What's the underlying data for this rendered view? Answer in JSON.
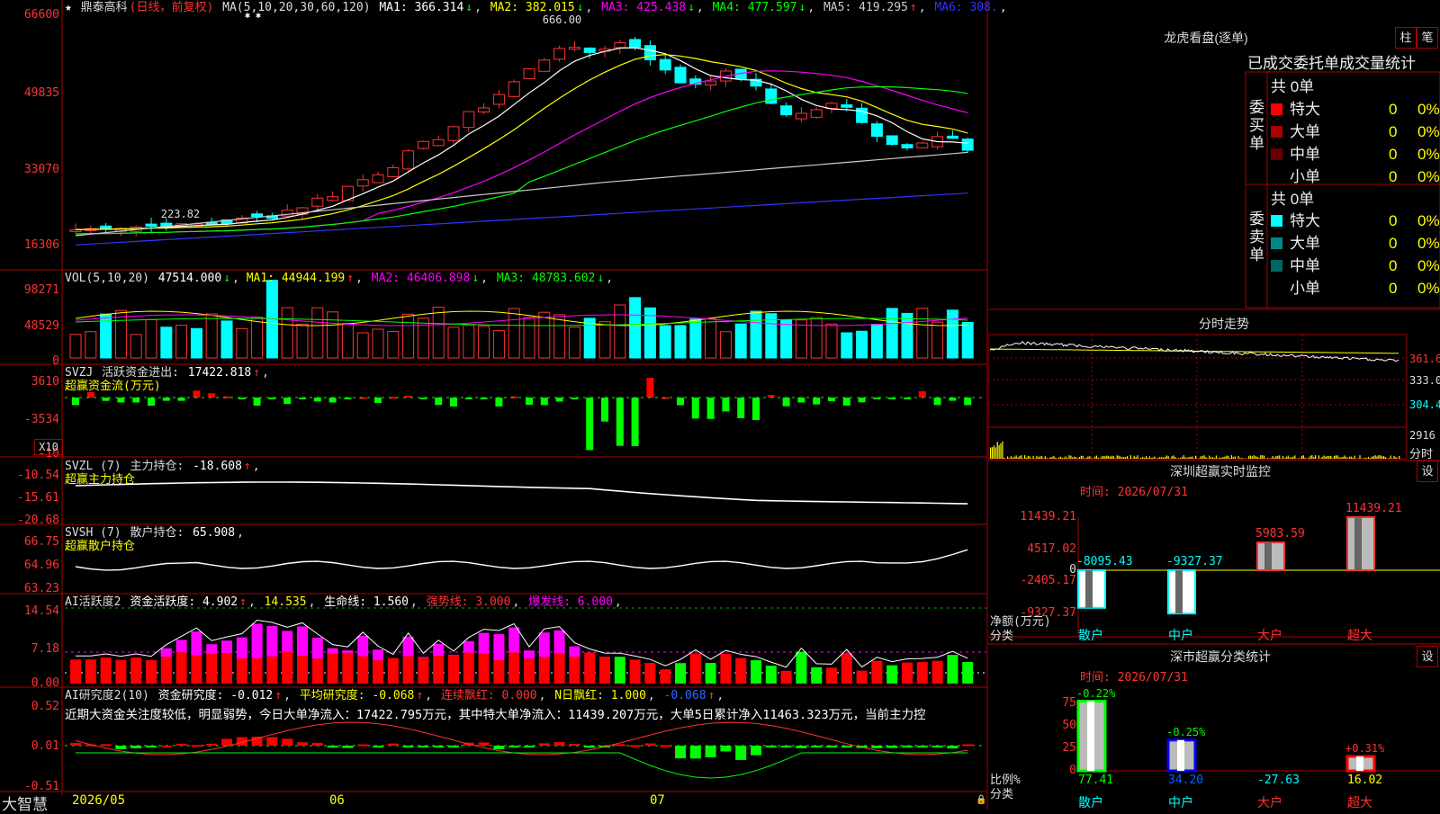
{
  "stock": {
    "name": "鼎泰高科",
    "period": "(日线，前复权)",
    "logo": "大智慧"
  },
  "panel_price": {
    "ma_prefix": "MA(5,10,20,30,60,120)",
    "ma": [
      {
        "label": "MA1:",
        "value": "366.314",
        "arrow": "↓",
        "color": "#ffffff"
      },
      {
        "label": "MA2:",
        "value": "382.015",
        "arrow": "↓",
        "color": "#ffff00"
      },
      {
        "label": "MA3:",
        "value": "425.438",
        "arrow": "↓",
        "color": "#ff00ff"
      },
      {
        "label": "MA4:",
        "value": "477.597",
        "arrow": "↓",
        "color": "#00ff00"
      },
      {
        "label": "MA5:",
        "value": "419.295",
        "arrow": "↑",
        "color": "#cccccc"
      },
      {
        "label": "MA6:",
        "value": "308.",
        "arrow": "",
        "color": "#3333ff"
      }
    ],
    "y_ticks": [
      "66600",
      "49835",
      "33070",
      "16306"
    ],
    "high_label": "666.00",
    "low_label": "223.82"
  },
  "panel_vol": {
    "title": "VOL(5,10,20)",
    "value": "47514.000",
    "items": [
      {
        "label": "MA1:",
        "value": "44944.199",
        "arrow": "↑",
        "color": "#ffff00"
      },
      {
        "label": "MA2:",
        "value": "46406.898",
        "arrow": "↓",
        "color": "#ff00ff"
      },
      {
        "label": "MA3:",
        "value": "48783.602",
        "arrow": "↓",
        "color": "#00ff00"
      }
    ],
    "y_ticks": [
      "98271",
      "48529",
      "0"
    ]
  },
  "panel_svzj": {
    "title": "SVZJ",
    "label": "活跃资金进出:",
    "value": "17422.818",
    "arrow": "↑",
    "sub": "超赢资金流(万元)",
    "y_ticks": [
      "3610",
      "-3534",
      "-10"
    ],
    "x10": "X10"
  },
  "panel_svzl": {
    "title": "SVZL (7)",
    "label": "主力持仓:",
    "value": "-18.608",
    "arrow": "↑",
    "sub": "超赢主力持仓",
    "y_ticks": [
      "-10.54",
      "-15.61",
      "-20.68"
    ]
  },
  "panel_svsh": {
    "title": "SVSH (7)",
    "label": "散户持仓:",
    "value": "65.908",
    "sub": "超赢散户持仓",
    "y_ticks": [
      "66.75",
      "64.96",
      "63.23"
    ]
  },
  "panel_ai1": {
    "title": "AI活跃度2",
    "items": [
      {
        "label": "资金活跃度:",
        "value": "4.902",
        "arrow": "↑",
        "color": "#ffffff"
      },
      {
        "label": "",
        "value": "14.535",
        "arrow": "",
        "color": "#ffff00"
      },
      {
        "label": "生命线:",
        "value": "1.560",
        "arrow": "",
        "color": "#ffffff"
      },
      {
        "label": "强势线:",
        "value": "3.000",
        "arrow": "",
        "color": "#ff3333"
      },
      {
        "label": "爆发线:",
        "value": "6.000",
        "arrow": "",
        "color": "#ff00ff"
      }
    ],
    "y_ticks": [
      "14.54",
      "7.18",
      "0.00"
    ]
  },
  "panel_ai2": {
    "title": "AI研究度2(10)",
    "items": [
      {
        "label": "资金研究度:",
        "value": "-0.012",
        "arrow": "↑",
        "color": "#ffffff"
      },
      {
        "label": "平均研究度:",
        "value": "-0.068",
        "arrow": "↑",
        "color": "#ffff00"
      },
      {
        "label": "连续飘红:",
        "value": "0.000",
        "arrow": "",
        "color": "#ff3333"
      },
      {
        "label": "N日飘红:",
        "value": "1.000",
        "arrow": "",
        "color": "#ffff00"
      },
      {
        "label": "",
        "value": "-0.068",
        "arrow": "↑",
        "color": "#3366ff"
      }
    ],
    "note": "近期大资金关注度较低，明显弱势，今日大单净流入：17422.795万元，其中特大单净流入：11439.207万元，大单5日累计净入11463.323万元，当前主力控",
    "y_ticks": [
      "0.52",
      "0.01",
      "-0.51"
    ]
  },
  "x_axis": [
    "2026/05",
    "06",
    "07"
  ],
  "dragon": {
    "title": "龙虎看盘(逐单)",
    "btn1": "柱",
    "btn2": "笔",
    "header": "已成交委托单成交量统计",
    "buy_side": "委买单",
    "sell_side": "委卖单",
    "buy_total": "共 0单",
    "sell_total": "共 0单",
    "buy_rows": [
      {
        "name": "特大",
        "val": "0",
        "pct": "0%",
        "color": "#ff0000"
      },
      {
        "name": "大单",
        "val": "0",
        "pct": "0%",
        "color": "#aa0000"
      },
      {
        "name": "中单",
        "val": "0",
        "pct": "0%",
        "color": "#660000"
      },
      {
        "name": "小单",
        "val": "0",
        "pct": "0%",
        "color": "#000000"
      }
    ],
    "sell_rows": [
      {
        "name": "特大",
        "val": "0",
        "pct": "0%",
        "color": "#00ffff"
      },
      {
        "name": "大单",
        "val": "0",
        "pct": "0%",
        "color": "#008888"
      },
      {
        "name": "中单",
        "val": "0",
        "pct": "0%",
        "color": "#006666"
      },
      {
        "name": "小单",
        "val": "0",
        "pct": "0%",
        "color": "#000000"
      }
    ]
  },
  "intraday": {
    "title": "分时走势",
    "y_labels": [
      "361.6",
      "333.0",
      "304.4"
    ],
    "vol_label": "2916",
    "x_label": "分时"
  },
  "monitor": {
    "title": "深圳超赢实时监控",
    "btn": "设",
    "time": "时间: 2026/07/31",
    "y_ticks": [
      "11439.21",
      "4517.02",
      "0",
      "-2405.17",
      "-9327.37"
    ],
    "unit": "净额(万元)",
    "cat_label": "分类"
  },
  "classify": {
    "title": "深市超赢分类统计",
    "btn": "设",
    "time": "时间: 2026/07/31",
    "y_ticks": [
      "75",
      "50",
      "25",
      "0"
    ],
    "unit": "比例%",
    "cat_label": "分类"
  },
  "chart_data": [
    {
      "type": "bar",
      "title": "深圳超赢实时监控",
      "categories": [
        "散户",
        "中户",
        "大户",
        "超大"
      ],
      "values": [
        -8095.43,
        -9327.37,
        5983.59,
        11439.21
      ],
      "ylabel": "净额(万元)",
      "ylim": [
        -9327.37,
        11439.21
      ]
    },
    {
      "type": "bar",
      "title": "深市超赢分类统计",
      "categories": [
        "散户",
        "中户",
        "大户",
        "超大"
      ],
      "values": [
        77.41,
        34.2,
        -27.63,
        16.02
      ],
      "top_labels": [
        "-0.22%",
        "-0.25%",
        "",
        "+0.31%"
      ],
      "ylabel": "比例%",
      "ylim": [
        0,
        75
      ]
    }
  ],
  "colors": {
    "up": "#ff0000",
    "down": "#00ffff",
    "grid": "#aa0000"
  }
}
